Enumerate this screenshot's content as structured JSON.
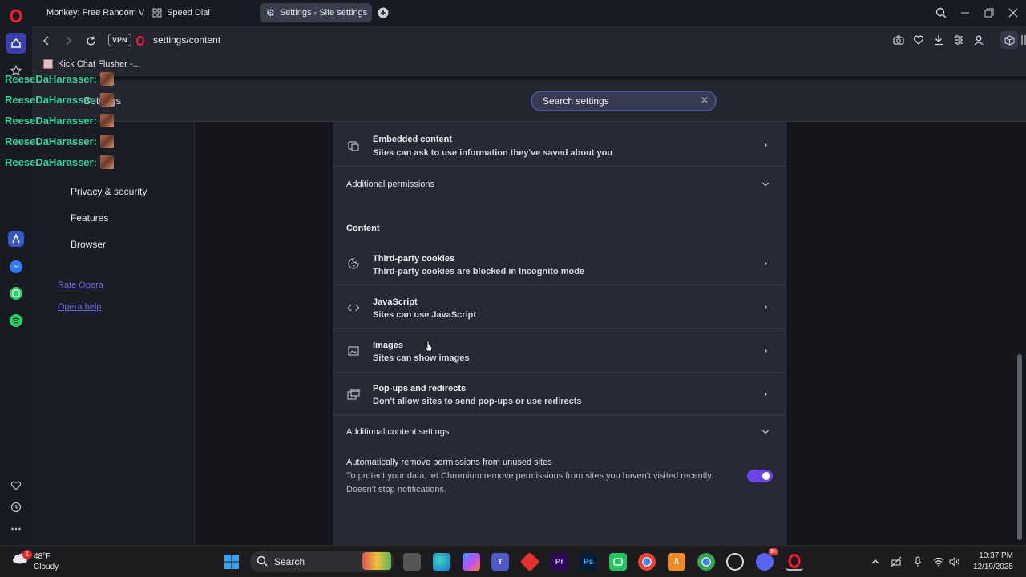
{
  "tabs": [
    {
      "label": "Monkey: Free Random Vid",
      "icon": "monkey-icon"
    },
    {
      "label": "Speed Dial",
      "icon": "speed-dial-icon"
    },
    {
      "label": "Settings - Site settings",
      "icon": "gear-icon",
      "active": true
    }
  ],
  "address": {
    "vpn": "VPN",
    "url": "settings/content"
  },
  "bookmarks": [
    {
      "label": "Kick Chat Flusher -..."
    }
  ],
  "header": {
    "title": "Settings",
    "search_placeholder": "Search settings"
  },
  "nav": {
    "items": [
      "Privacy & security",
      "Features",
      "Browser"
    ],
    "links": [
      "Rate Opera",
      "Opera help"
    ]
  },
  "panel": {
    "embedded": {
      "title": "Embedded content",
      "subtitle": "Sites can ask to use information they've saved about you"
    },
    "additional_permissions": "Additional permissions",
    "content_heading": "Content",
    "rows": [
      {
        "title": "Third-party cookies",
        "subtitle": "Third-party cookies are blocked in Incognito mode",
        "icon": "cookie-icon"
      },
      {
        "title": "JavaScript",
        "subtitle": "Sites can use JavaScript",
        "icon": "code-icon"
      },
      {
        "title": "Images",
        "subtitle": "Sites can show images",
        "icon": "image-icon"
      },
      {
        "title": "Pop-ups and redirects",
        "subtitle": "Don't allow sites to send pop-ups or use redirects",
        "icon": "popup-icon"
      }
    ],
    "additional_content": "Additional content settings",
    "auto_remove": {
      "title": "Automatically remove permissions from unused sites",
      "desc1": "To protect your data, let Chromium remove permissions from sites you haven't visited recently.",
      "desc2": "Doesn't stop notifications.",
      "enabled": true
    }
  },
  "overlay": {
    "chat_name": "ReeseDaHarasser:",
    "lines": 5
  },
  "taskbar": {
    "weather_temp": "48°F",
    "weather_desc": "Cloudy",
    "weather_badge": "1",
    "search": "Search",
    "time": "10:37 PM",
    "date": "12/19/2025",
    "discord_badge": "9+"
  },
  "colors": {
    "accent": "#6d43e8",
    "overlay_text": "#32d8a2",
    "link": "#6a66e6"
  }
}
